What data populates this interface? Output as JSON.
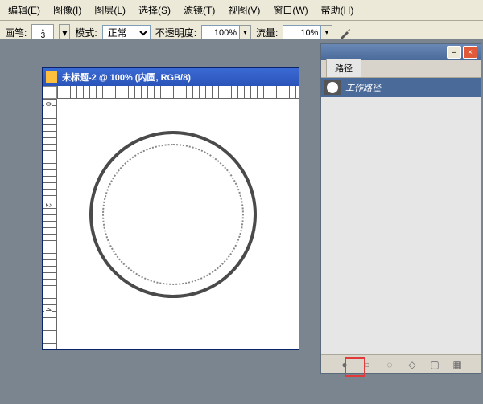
{
  "menu": {
    "edit": "编辑(E)",
    "image": "图像(I)",
    "layer": "图层(L)",
    "select": "选择(S)",
    "filter": "滤镜(T)",
    "view": "视图(V)",
    "window": "窗口(W)",
    "help": "帮助(H)"
  },
  "toolbar": {
    "brush_label": "画笔:",
    "brush_size": "3",
    "mode_label": "模式:",
    "mode_value": "正常",
    "opacity_label": "不透明度:",
    "opacity_value": "100%",
    "flow_label": "流量:",
    "flow_value": "10%"
  },
  "document": {
    "title": "未标题-2 @ 100% (内圆, RGB/8)"
  },
  "paths_panel": {
    "tab_label": "路径",
    "work_path_label": "工作路径"
  },
  "ruler_marks": [
    "0",
    "2",
    "4"
  ],
  "icons": {
    "chevron_down": "▾",
    "minimize": "–",
    "close": "×",
    "fill": "●",
    "stroke": "○",
    "selection": "◌",
    "new": "◇",
    "trash": "▦"
  }
}
